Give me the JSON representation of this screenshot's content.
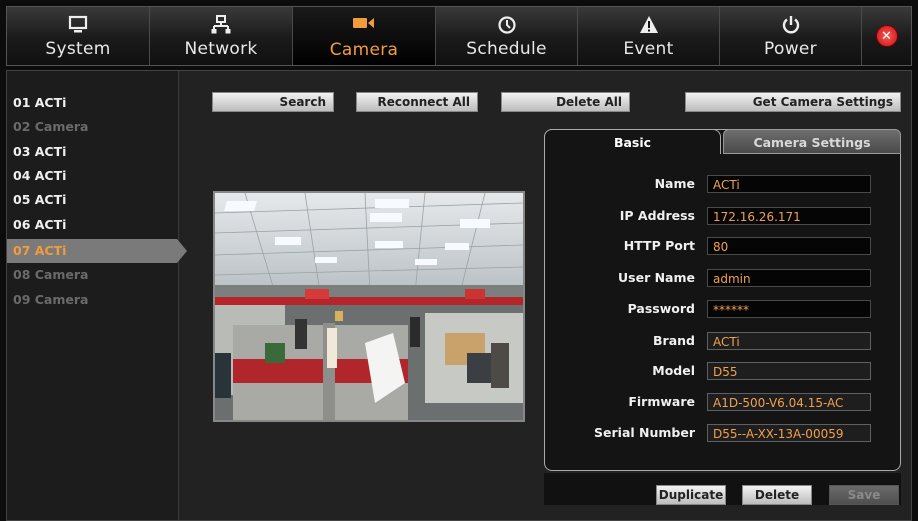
{
  "nav": {
    "tabs": [
      {
        "label": "System",
        "icon": "monitor-icon"
      },
      {
        "label": "Network",
        "icon": "network-icon"
      },
      {
        "label": "Camera",
        "icon": "camera-icon",
        "active": true
      },
      {
        "label": "Schedule",
        "icon": "clock-icon"
      },
      {
        "label": "Event",
        "icon": "warning-icon"
      },
      {
        "label": "Power",
        "icon": "power-icon"
      }
    ],
    "close_icon": "close-icon",
    "active_color": "#f39c3c"
  },
  "toolbar": {
    "search": "Search",
    "reconnect_all": "Reconnect All",
    "delete_all": "Delete All",
    "get_camera_settings": "Get Camera Settings"
  },
  "camera_list": [
    {
      "label": "01 ACTi",
      "state": "connected"
    },
    {
      "label": "02 Camera",
      "state": "empty"
    },
    {
      "label": "03 ACTi",
      "state": "connected"
    },
    {
      "label": "04 ACTi",
      "state": "connected"
    },
    {
      "label": "05 ACTi",
      "state": "connected"
    },
    {
      "label": "06 ACTi",
      "state": "connected"
    },
    {
      "label": "07 ACTi",
      "state": "selected"
    },
    {
      "label": "08 Camera",
      "state": "empty"
    },
    {
      "label": "09 Camera",
      "state": "empty"
    }
  ],
  "settings": {
    "tabs": {
      "basic": "Basic",
      "camera_settings": "Camera Settings"
    },
    "fields": [
      {
        "label": "Name",
        "value": "ACTi",
        "editable": true
      },
      {
        "label": "IP Address",
        "value": "172.16.26.171",
        "editable": true
      },
      {
        "label": "HTTP Port",
        "value": "80",
        "editable": true
      },
      {
        "label": "User Name",
        "value": "admin",
        "editable": true
      },
      {
        "label": "Password",
        "value": "******",
        "editable": true
      },
      {
        "label": "Brand",
        "value": "ACTi",
        "editable": false
      },
      {
        "label": "Model",
        "value": "D55",
        "editable": false
      },
      {
        "label": "Firmware",
        "value": "A1D-500-V6.04.15-AC",
        "editable": false
      },
      {
        "label": "Serial Number",
        "value": "D55--A-XX-13A-00059",
        "editable": false
      }
    ]
  },
  "actions": {
    "duplicate": "Duplicate",
    "delete": "Delete",
    "save": "Save"
  }
}
